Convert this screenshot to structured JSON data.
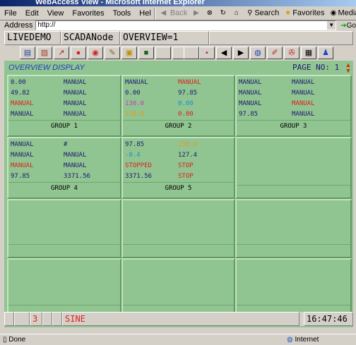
{
  "window": {
    "title": "WebAccess View - Microsoft Internet Explorer"
  },
  "menu": [
    "File",
    "Edit",
    "View",
    "Favorites",
    "Tools",
    "Hel"
  ],
  "toolbar_ie": {
    "back": "Back",
    "search": "Search",
    "favorites": "Favorites",
    "media": "Media"
  },
  "address": {
    "label": "Address",
    "value": "http://",
    "go": "Go"
  },
  "header": {
    "node": "LIVEDEMO",
    "scada": "SCADANode",
    "view": "OVERVIEW=1"
  },
  "overview": {
    "title": "OVERVIEW DISPLAY",
    "page_label": "PAGE NO:",
    "page_num": "1"
  },
  "colors": {
    "blue": "#1b1b70",
    "red": "#e02020",
    "orange": "#e89a20",
    "magenta": "#c040c0",
    "cyan": "#2090d0",
    "panel": "#90c490"
  },
  "groups": [
    {
      "label": "GROUP 1",
      "rows": [
        [
          {
            "t": "0.00",
            "c": "blue"
          },
          {
            "t": "MANUAL",
            "c": "blue"
          }
        ],
        [
          {
            "t": "49.82",
            "c": "blue"
          },
          {
            "t": "MANUAL",
            "c": "blue"
          }
        ],
        [
          {
            "t": "MANUAL",
            "c": "red"
          },
          {
            "t": "MANUAL",
            "c": "blue"
          }
        ],
        [
          {
            "t": "MANUAL",
            "c": "blue"
          },
          {
            "t": "MANUAL",
            "c": "blue"
          }
        ]
      ]
    },
    {
      "label": "GROUP 2",
      "rows": [
        [
          {
            "t": "MANUAL",
            "c": "blue"
          },
          {
            "t": "MANUAL",
            "c": "red"
          }
        ],
        [
          {
            "t": "0.00",
            "c": "blue"
          },
          {
            "t": "97.85",
            "c": "blue"
          }
        ],
        [
          {
            "t": "130.0",
            "c": "magenta"
          },
          {
            "t": "0.00",
            "c": "cyan"
          }
        ],
        [
          {
            "t": "130.0",
            "c": "orange"
          },
          {
            "t": "0.00",
            "c": "red"
          }
        ]
      ]
    },
    {
      "label": "GROUP 3",
      "rows": [
        [
          {
            "t": "MANUAL",
            "c": "blue"
          },
          {
            "t": "MANUAL",
            "c": "blue"
          }
        ],
        [
          {
            "t": "MANUAL",
            "c": "blue"
          },
          {
            "t": "MANUAL",
            "c": "blue"
          }
        ],
        [
          {
            "t": "MANUAL",
            "c": "blue"
          },
          {
            "t": "MANUAL",
            "c": "red"
          }
        ],
        [
          {
            "t": "97.85",
            "c": "blue"
          },
          {
            "t": "MANUAL",
            "c": "blue"
          }
        ]
      ]
    },
    {
      "label": "GROUP 4",
      "rows": [
        [
          {
            "t": "MANUAL",
            "c": "blue"
          },
          {
            "t": "#",
            "c": "blue"
          }
        ],
        [
          {
            "t": "MANUAL",
            "c": "blue"
          },
          {
            "t": "MANUAL",
            "c": "blue"
          }
        ],
        [
          {
            "t": "MANUAL",
            "c": "red"
          },
          {
            "t": "MANUAL",
            "c": "blue"
          }
        ],
        [
          {
            "t": "97.85",
            "c": "blue"
          },
          {
            "t": "3371.56",
            "c": "blue"
          }
        ]
      ]
    },
    {
      "label": "GROUP 5",
      "rows": [
        [
          {
            "t": "97.85",
            "c": "blue"
          },
          {
            "t": "130.0",
            "c": "orange"
          }
        ],
        [
          {
            "t": "-0.4",
            "c": "cyan"
          },
          {
            "t": "127.4",
            "c": "blue"
          }
        ],
        [
          {
            "t": "STOPPED",
            "c": "red"
          },
          {
            "t": "STOP",
            "c": "red"
          }
        ],
        [
          {
            "t": "3371.56",
            "c": "blue"
          },
          {
            "t": "STOP",
            "c": "red"
          }
        ]
      ]
    }
  ],
  "status": {
    "num": "3",
    "text": "SINE",
    "time": "16:47:46"
  },
  "iestatus": {
    "done": "Done",
    "zone": "Internet"
  }
}
